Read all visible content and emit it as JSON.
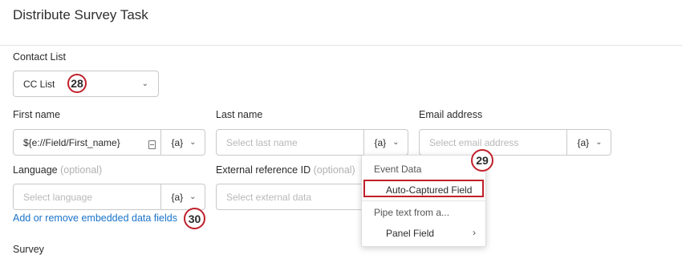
{
  "header": {
    "title": "Distribute Survey Task"
  },
  "contact_list": {
    "label": "Contact List",
    "value": "CC List",
    "marker": "28"
  },
  "first_name": {
    "label": "First name",
    "value": "${e://Field/First_name}",
    "pipe": "{a}"
  },
  "last_name": {
    "label": "Last name",
    "placeholder": "Select last name",
    "pipe": "{a}"
  },
  "email": {
    "label": "Email address",
    "placeholder": "Select email address",
    "pipe": "{a}"
  },
  "language": {
    "label": "Language",
    "optional": "(optional)",
    "placeholder": "Select language",
    "pipe": "{a}"
  },
  "external_ref": {
    "label": "External reference ID",
    "optional": "(optional)",
    "placeholder": "Select external data"
  },
  "embedded_link": {
    "label": "Add or remove embedded data fields",
    "marker": "30"
  },
  "survey": {
    "label": "Survey"
  },
  "dropdown": {
    "marker": "29",
    "event_data_header": "Event Data",
    "auto_captured": "Auto-Captured Field",
    "pipe_text_header": "Pipe text from a...",
    "panel_field": "Panel Field"
  },
  "icons": {
    "chevron": "chevron-down-icon",
    "submenu": "chevron-right-icon",
    "document": "document-icon"
  }
}
